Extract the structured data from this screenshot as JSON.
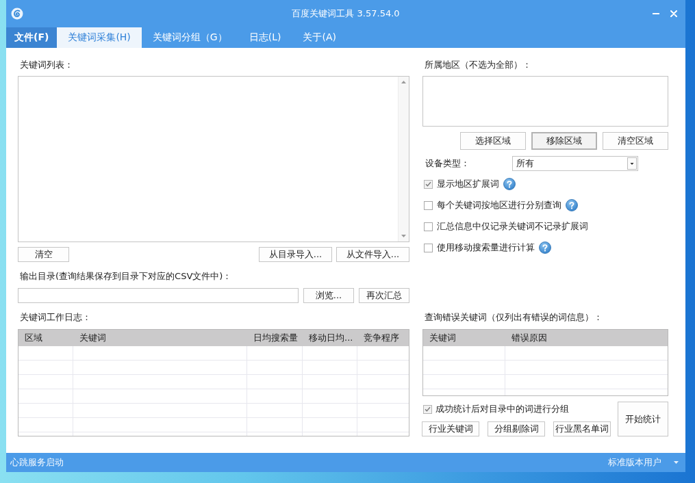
{
  "window": {
    "title": "百度关键词工具 3.57.54.0"
  },
  "menu_tabs": [
    {
      "label": "文件(F)",
      "kind": "menu",
      "selected": false
    },
    {
      "label": "关键词采集(H)",
      "kind": "tab",
      "selected": true
    },
    {
      "label": "关键词分组（G）",
      "kind": "tab",
      "selected": false
    },
    {
      "label": "日志(L)",
      "kind": "tab",
      "selected": false
    },
    {
      "label": "关于(A)",
      "kind": "tab",
      "selected": false
    }
  ],
  "keyword_list": {
    "label": "关键词列表：",
    "left_buttons": [
      "清空"
    ],
    "right_buttons": [
      "从目录导入...",
      "从文件导入..."
    ]
  },
  "output_directory": {
    "label": "输出目录(查询结果保存到目录下对应的CSV文件中)：",
    "buttons": [
      "浏览...",
      "再次汇总"
    ]
  },
  "work_log": {
    "label": "关键词工作日志：",
    "columns": [
      "区域",
      "关键词",
      "日均搜索量",
      "移动日均...",
      "竞争程序"
    ]
  },
  "region": {
    "label": "所属地区（不选为全部）：",
    "buttons": [
      {
        "label": "选择区域",
        "focused": false
      },
      {
        "label": "移除区域",
        "focused": true
      },
      {
        "label": "清空区域",
        "focused": false
      }
    ]
  },
  "device_type": {
    "label": "设备类型：",
    "value": "所有"
  },
  "options": [
    {
      "label": "显示地区扩展词",
      "checked": true,
      "help": true
    },
    {
      "label": "每个关键词按地区进行分别查询",
      "checked": false,
      "help": true
    },
    {
      "label": "汇总信息中仅记录关键词不记录扩展词",
      "checked": false,
      "help": false
    },
    {
      "label": "使用移动搜索量进行计算",
      "checked": false,
      "help": true
    }
  ],
  "error_keywords": {
    "label": "查询错误关键词（仅列出有错误的词信息）：",
    "columns": [
      "关键词",
      "错误原因"
    ]
  },
  "grouping": {
    "label": "成功统计后对目录中的词进行分组",
    "checked": true,
    "buttons": [
      "行业关键词",
      "分组剔除词",
      "行业黑名单词"
    ]
  },
  "start_button": "开始统计",
  "status_bar": {
    "left": "心跳服务启动",
    "right": "标准版本用户"
  }
}
